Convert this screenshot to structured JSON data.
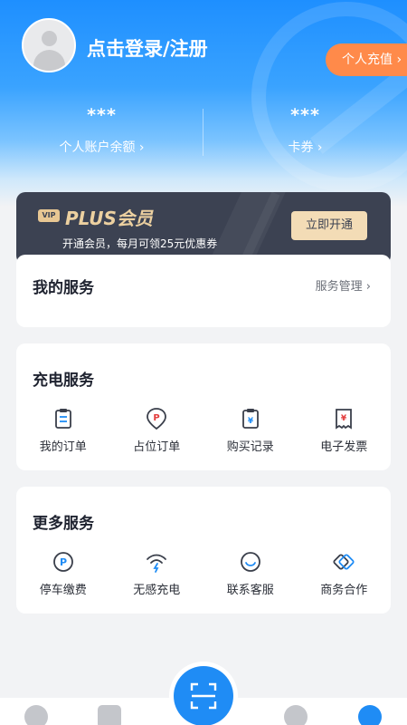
{
  "header": {
    "login_title": "点击登录/注册",
    "recharge_label": "个人充值",
    "recharge_chevron": "›",
    "balance_value": "***",
    "balance_label": "个人账户余额 ›",
    "coupon_value": "***",
    "coupon_label": "卡券 ›"
  },
  "plus": {
    "badge": "VIP",
    "title": "PLUS会员",
    "subtitle": "开通会员，每月可领25元优惠券",
    "button_label": "立即开通"
  },
  "my_services": {
    "title": "我的服务",
    "manage_label": "服务管理 ›"
  },
  "charging_services": {
    "title": "充电服务",
    "items": [
      {
        "label": "我的订单",
        "icon": "clipboard-icon"
      },
      {
        "label": "占位订单",
        "icon": "parking-pin-icon"
      },
      {
        "label": "购买记录",
        "icon": "purchase-record-icon"
      },
      {
        "label": "电子发票",
        "icon": "invoice-icon"
      }
    ]
  },
  "more_services": {
    "title": "更多服务",
    "items": [
      {
        "label": "停车缴费",
        "icon": "parking-icon"
      },
      {
        "label": "无感充电",
        "icon": "wireless-charge-icon"
      },
      {
        "label": "联系客服",
        "icon": "customer-service-icon"
      },
      {
        "label": "商务合作",
        "icon": "handshake-icon"
      }
    ]
  },
  "tabbar": {
    "icons": [
      "lightning-icon",
      "station-icon",
      "scan-icon",
      "community-icon",
      "profile-icon"
    ],
    "active_color": "#1f8cf5",
    "inactive_color": "#c4c6cb"
  },
  "colors": {
    "primary_blue": "#1e8fff",
    "recharge_orange": "#ff8a4a",
    "plus_dark": "#3c4252",
    "plus_gold": "#ecd0a0"
  }
}
